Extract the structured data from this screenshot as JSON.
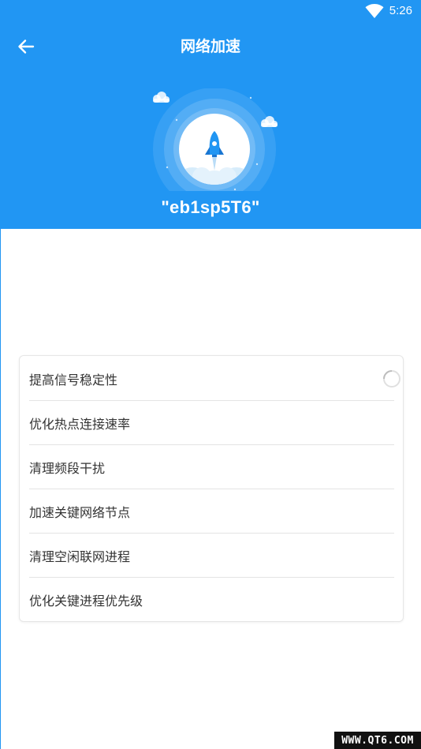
{
  "status_bar": {
    "time": "5:26",
    "wifi_icon": "wifi-icon"
  },
  "header": {
    "title": "网络加速",
    "back_icon": "arrow-left-icon",
    "illustration_icon": "rocket-icon",
    "network_name": "\"eb1sp5T6\"",
    "background_color": "#2196f3"
  },
  "tasks": [
    {
      "label": "提高信号稳定性",
      "status": "loading"
    },
    {
      "label": "优化热点连接速率"
    },
    {
      "label": "清理频段干扰"
    },
    {
      "label": "加速关键网络节点"
    },
    {
      "label": "清理空闲联网进程"
    },
    {
      "label": "优化关键进程优先级"
    }
  ],
  "watermark": "WWW.QT6.COM"
}
